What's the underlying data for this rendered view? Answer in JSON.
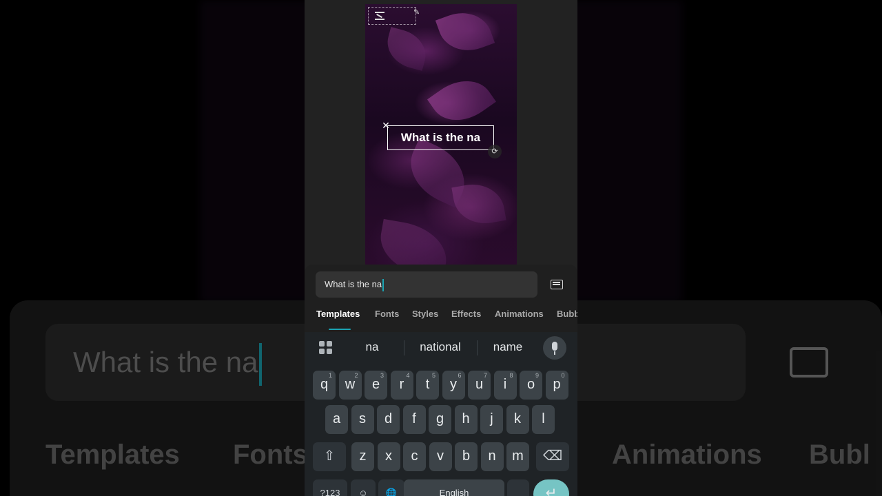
{
  "background": {
    "input_text": "What is the na",
    "tabs": [
      "Templates",
      "Fonts",
      "Animations",
      "Bubl"
    ]
  },
  "preview": {
    "overlay_text": "What is the na",
    "close_glyph": "✕",
    "rotate_glyph": "⟳",
    "pencil_glyph": "✎"
  },
  "editor": {
    "input_value": "What is the na",
    "keyboard_toggle_icon": "keyboard-icon",
    "tabs": [
      {
        "label": "Templates",
        "active": true
      },
      {
        "label": "Fonts",
        "active": false
      },
      {
        "label": "Styles",
        "active": false
      },
      {
        "label": "Effects",
        "active": false
      },
      {
        "label": "Animations",
        "active": false
      },
      {
        "label": "Bubbl",
        "active": false
      }
    ],
    "accent_color": "#1ba4b3"
  },
  "keyboard": {
    "suggestions": [
      "na",
      "national",
      "name"
    ],
    "row1": [
      {
        "k": "q",
        "h": "1"
      },
      {
        "k": "w",
        "h": "2"
      },
      {
        "k": "e",
        "h": "3"
      },
      {
        "k": "r",
        "h": "4"
      },
      {
        "k": "t",
        "h": "5"
      },
      {
        "k": "y",
        "h": "6"
      },
      {
        "k": "u",
        "h": "7"
      },
      {
        "k": "i",
        "h": "8"
      },
      {
        "k": "o",
        "h": "9"
      },
      {
        "k": "p",
        "h": "0"
      }
    ],
    "row2": [
      "a",
      "s",
      "d",
      "f",
      "g",
      "h",
      "j",
      "k",
      "l"
    ],
    "row3": [
      "z",
      "x",
      "c",
      "v",
      "b",
      "n",
      "m"
    ],
    "shift_glyph": "⇧",
    "backspace_glyph": "⌫",
    "symbols_label": "?123",
    "emoji_glyph": "☺",
    "globe_glyph": "🌐",
    "space_label": "English",
    "enter_glyph": "↵"
  }
}
